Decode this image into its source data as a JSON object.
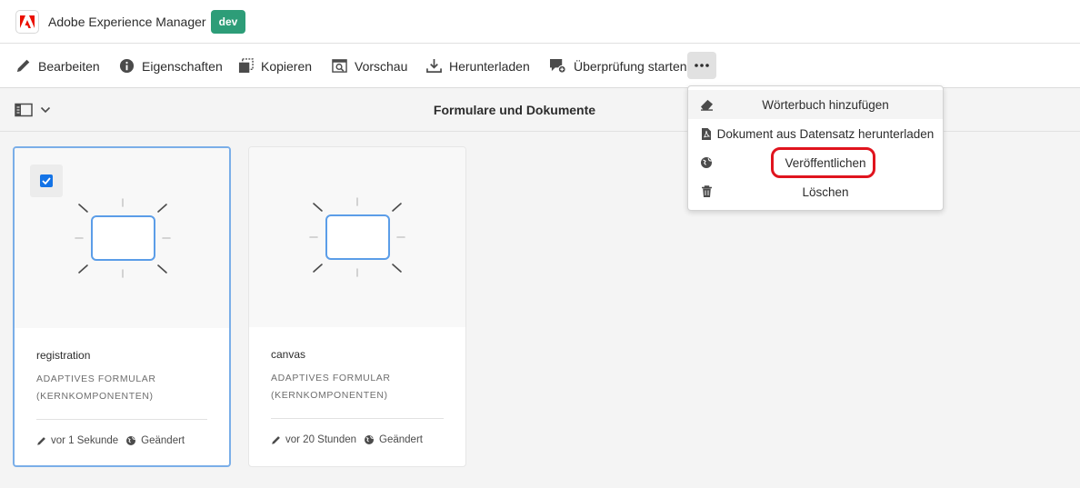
{
  "app": {
    "title": "Adobe Experience Manager",
    "environment": "dev",
    "environment_color": "#2d9d78",
    "logo_color": "#eb1000"
  },
  "toolbar": {
    "actions": [
      {
        "label": "Bearbeiten",
        "icon": "pencil-icon"
      },
      {
        "label": "Eigenschaften",
        "icon": "info-icon"
      },
      {
        "label": "Kopieren",
        "icon": "copy-icon"
      },
      {
        "label": "Vorschau",
        "icon": "preview-icon"
      },
      {
        "label": "Herunterladen",
        "icon": "download-icon"
      },
      {
        "label": "Überprüfung starten",
        "icon": "review-icon"
      }
    ],
    "more_icon": "more-icon"
  },
  "page": {
    "title": "Formulare und Dokumente",
    "rail_icon": "rail-toggle-icon"
  },
  "menu": {
    "items": [
      {
        "label": "Wörterbuch hinzufügen",
        "icon": "eraser-icon"
      },
      {
        "label": "Dokument aus Datensatz herunterladen",
        "icon": "pdf-file-icon"
      },
      {
        "label": "Veröffentlichen",
        "icon": "globe-icon"
      },
      {
        "label": "Löschen",
        "icon": "trash-icon"
      }
    ],
    "highlight_color": "#e0141e"
  },
  "cards": [
    {
      "name": "registration",
      "type": "ADAPTIVES FORMULAR (KERNKOMPONENTEN)",
      "modified": "vor 1 Sekunde",
      "status": "Geändert",
      "selected": true
    },
    {
      "name": "canvas",
      "type": "ADAPTIVES FORMULAR (KERNKOMPONENTEN)",
      "modified": "vor 20 Stunden",
      "status": "Geändert",
      "selected": false
    }
  ]
}
